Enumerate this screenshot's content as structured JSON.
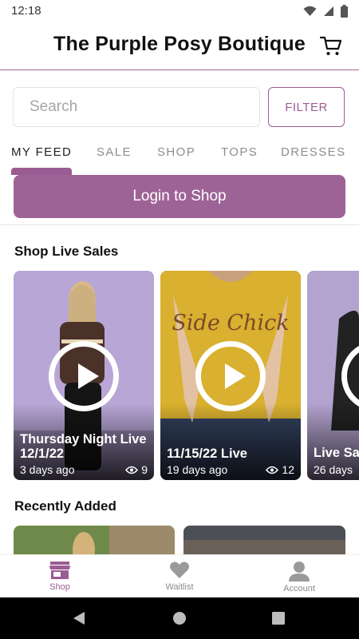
{
  "status_bar": {
    "time": "12:18"
  },
  "header": {
    "title": "The Purple Posy Boutique",
    "cart_icon": "cart-icon"
  },
  "search": {
    "placeholder": "Search",
    "value": ""
  },
  "filter_label": "FILTER",
  "tabs": [
    {
      "label": "MY FEED",
      "active": true
    },
    {
      "label": "SALE"
    },
    {
      "label": "SHOP"
    },
    {
      "label": "TOPS"
    },
    {
      "label": "DRESSES"
    }
  ],
  "login_label": "Login to Shop",
  "live_sales": {
    "title": "Shop Live Sales",
    "cards": [
      {
        "title": "Thursday Night Live 12/1/22",
        "time": "3 days ago",
        "views": "9"
      },
      {
        "title": "11/15/22 Live",
        "time": "19 days ago",
        "views": "12"
      },
      {
        "title": "Live Sa",
        "time": "26 days"
      }
    ],
    "shirt_text": "Side Chick"
  },
  "recently_added": {
    "title": "Recently Added"
  },
  "bottom_nav": [
    {
      "label": "Shop",
      "icon": "store-icon",
      "active": true
    },
    {
      "label": "Waitlist",
      "icon": "heart-icon"
    },
    {
      "label": "Account",
      "icon": "account-icon"
    }
  ],
  "colors": {
    "accent": "#9a5c92",
    "login_bg": "#9e6396",
    "text": "#111111",
    "muted": "#8e8e8e"
  }
}
